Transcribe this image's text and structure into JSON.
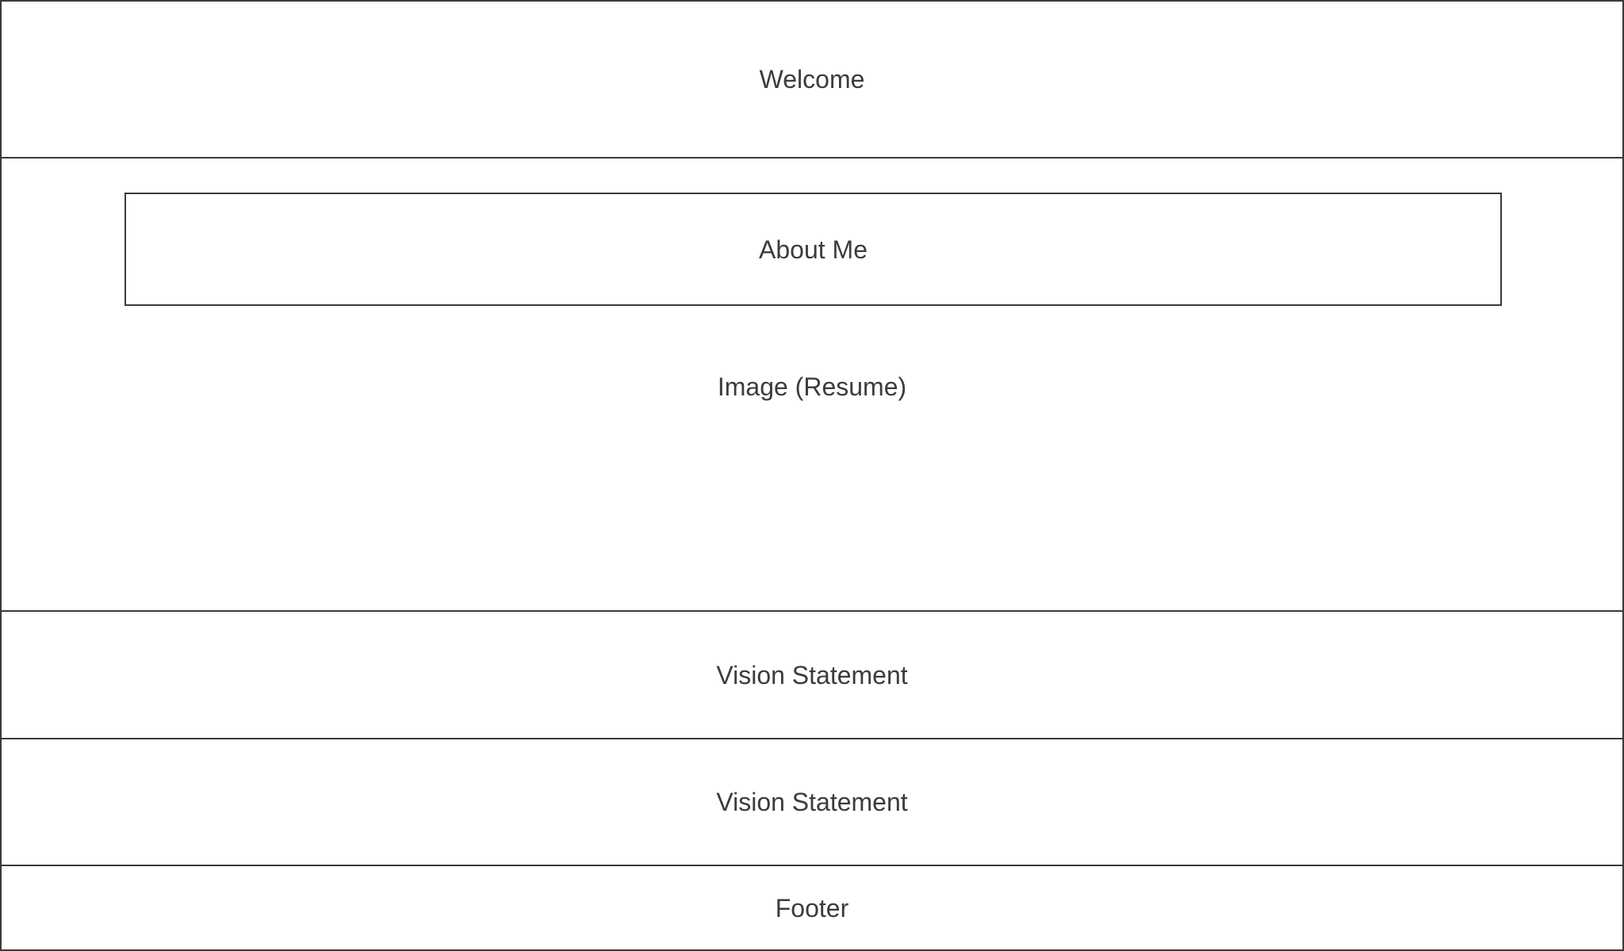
{
  "sections": {
    "welcome": "Welcome",
    "about": "About Me",
    "image": "Image (Resume)",
    "vision_1": "Vision Statement",
    "vision_2": "Vision Statement",
    "footer": "Footer"
  }
}
